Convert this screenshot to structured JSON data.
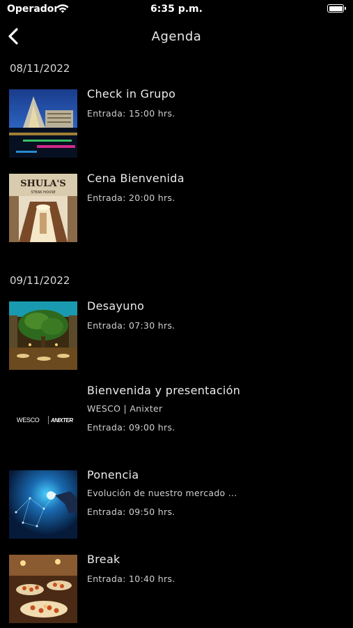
{
  "status_bar": {
    "carrier": "Operador",
    "time": "6:35 p.m."
  },
  "nav": {
    "title": "Agenda"
  },
  "days": [
    {
      "date": "08/11/2022",
      "events": [
        {
          "title": "Check in Grupo",
          "entrada": "Entrada: 15:00 hrs.",
          "image": "resort-night-photo"
        },
        {
          "title": "Cena Bienvenida",
          "entrada": "Entrada: 20:00 hrs.",
          "image": "shulas-steak-house-photo",
          "image_text": "SHULA'S STEAK HOUSE"
        }
      ]
    },
    {
      "date": "09/11/2022",
      "events": [
        {
          "title": "Desayuno",
          "entrada": "Entrada: 07:30 hrs.",
          "image": "atrium-restaurant-photo"
        },
        {
          "title": "Bienvenida y presentación",
          "subtitle": "WESCO | Anixter",
          "entrada": "Entrada: 09:00 hrs.",
          "image": "wesco-anixter-logo",
          "image_text": "WESCO | ANIXTER"
        },
        {
          "title": "Ponencia",
          "subtitle": "Evolución de nuestro mercado ...",
          "entrada": "Entrada: 09:50 hrs.",
          "image": "digital-network-photo"
        },
        {
          "title": "Break",
          "entrada": "Entrada: 10:40 hrs.",
          "image": "buffet-photo"
        }
      ]
    }
  ]
}
